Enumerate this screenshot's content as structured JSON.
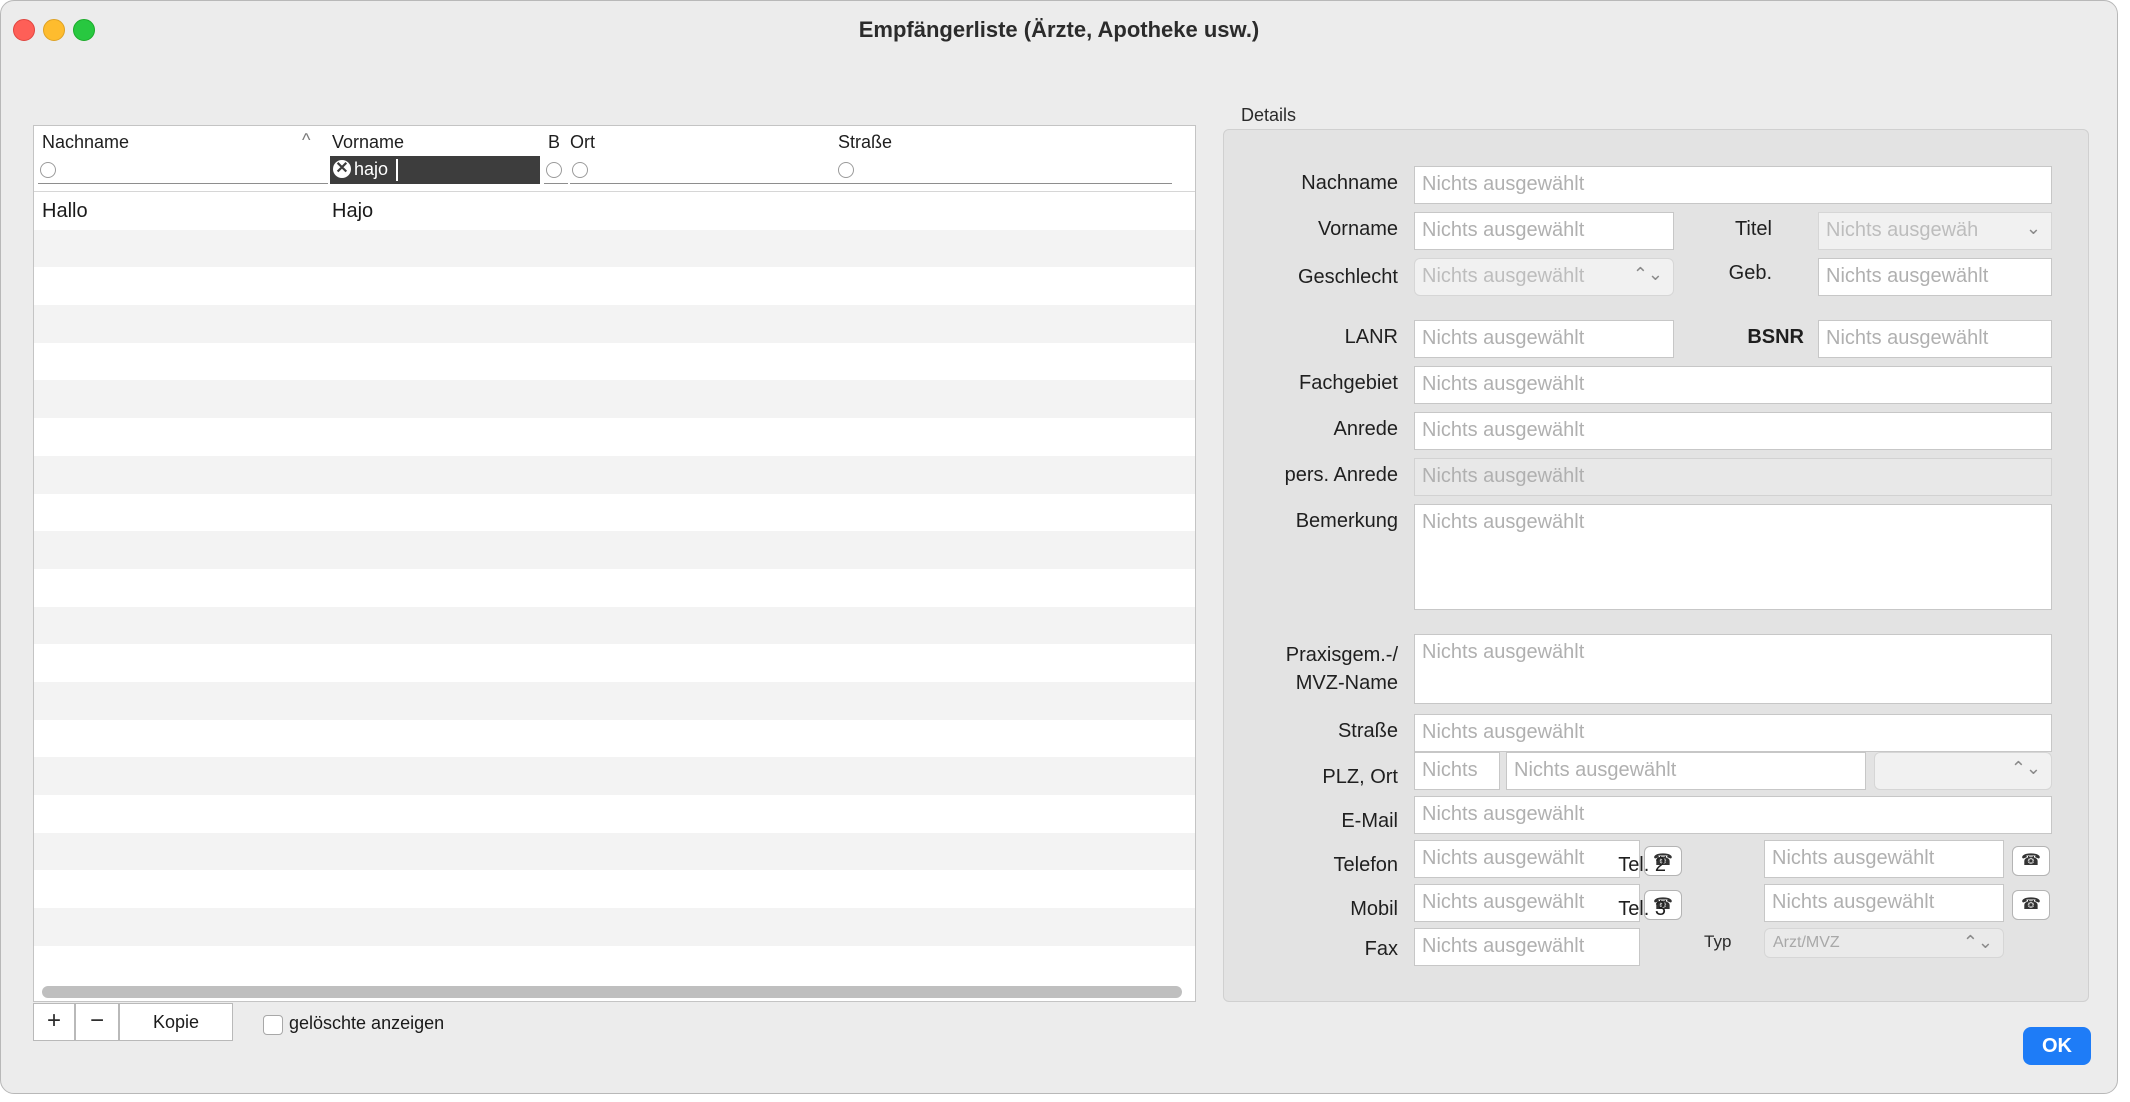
{
  "window": {
    "title": "Empfängerliste (Ärzte, Apotheke usw.)"
  },
  "table": {
    "columns": {
      "nachname": "Nachname",
      "vorname": "Vorname",
      "b": "B",
      "ort": "Ort",
      "strasse": "Straße"
    },
    "filter_vorname": "hajo",
    "rows": [
      {
        "nachname": "Hallo",
        "vorname": "Hajo"
      }
    ]
  },
  "bottom": {
    "add": "+",
    "remove": "−",
    "kopie": "Kopie",
    "show_deleted": "gelöschte anzeigen",
    "ok": "OK"
  },
  "details": {
    "title": "Details",
    "placeholder": "Nichts ausgewählt",
    "placeholder_short": "Nichts",
    "placeholder_titel": "Nichts ausgewäh",
    "labels": {
      "nachname": "Nachname",
      "vorname": "Vorname",
      "titel": "Titel",
      "geschlecht": "Geschlecht",
      "geb": "Geb.",
      "lanr": "LANR",
      "bsnr": "BSNR",
      "fachgebiet": "Fachgebiet",
      "anrede": "Anrede",
      "pers_anrede": "pers. Anrede",
      "bemerkung": "Bemerkung",
      "praxis1": "Praxisgem.-/",
      "praxis2": "MVZ-Name",
      "strasse": "Straße",
      "plz_ort": "PLZ, Ort",
      "email": "E-Mail",
      "telefon": "Telefon",
      "tel2": "Tel. 2",
      "mobil": "Mobil",
      "tel3": "Tel. 3",
      "fax": "Fax",
      "typ": "Typ"
    },
    "typ_value": "Arzt/MVZ"
  },
  "icons": {
    "phone": "☎",
    "select_arrows": "⌃⌄",
    "chevron": "⌄",
    "sort_up": "^",
    "clear": "⊗"
  }
}
